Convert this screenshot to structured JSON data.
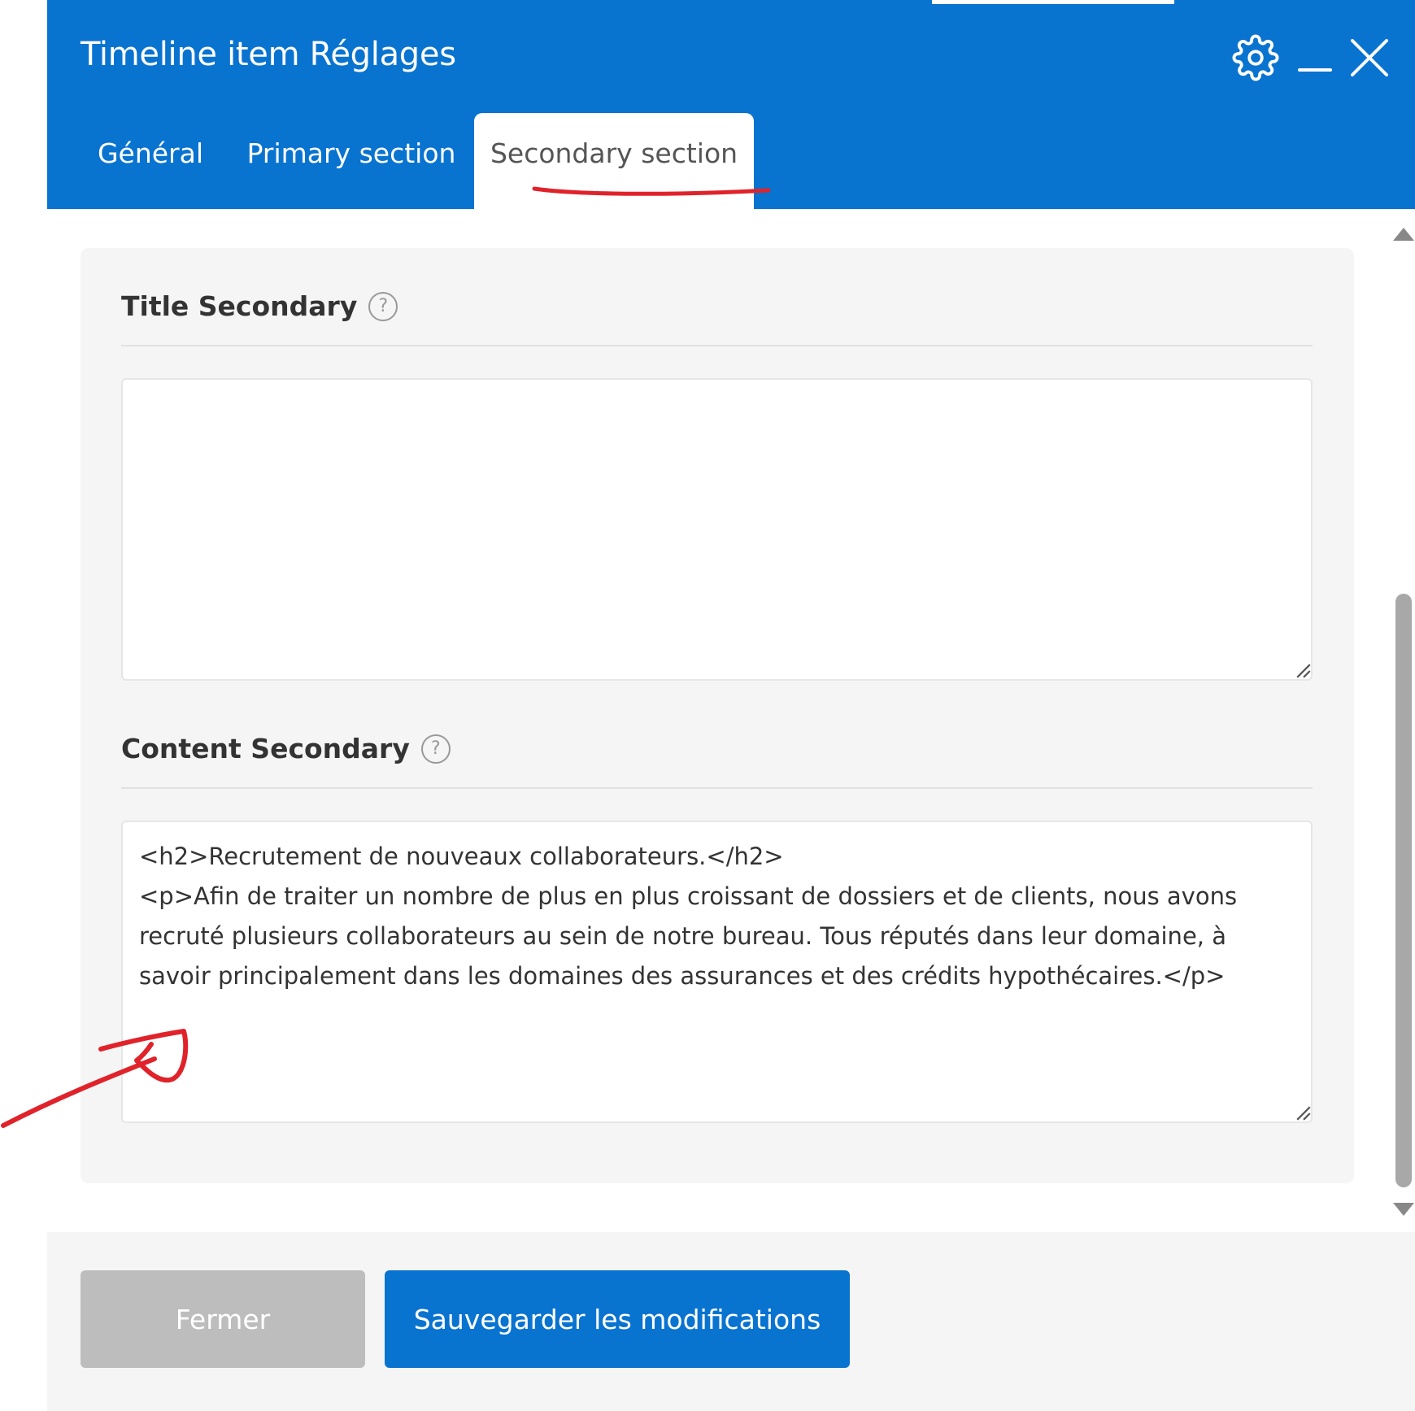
{
  "modal": {
    "title": "Timeline item Réglages"
  },
  "icons": {
    "settings": "gear-icon",
    "minimize": "minimize-icon",
    "close": "close-icon",
    "help": "question-circle-icon"
  },
  "tabs": [
    {
      "label": "Général",
      "active": false
    },
    {
      "label": "Primary section",
      "active": false
    },
    {
      "label": "Secondary section",
      "active": true
    }
  ],
  "fields": {
    "title_secondary": {
      "label": "Title Secondary",
      "help": "?",
      "value": ""
    },
    "content_secondary": {
      "label": "Content Secondary",
      "help": "?",
      "value": "<h2>Recrutement de nouveaux collaborateurs.</h2>\n<p>Afin de traiter un nombre de plus en plus croissant de dossiers et de clients, nous avons recruté plusieurs collaborateurs au sein de notre bureau. Tous réputés dans leur domaine, à savoir principalement dans les domaines des assurances et des crédits hypothécaires.</p>"
    }
  },
  "footer": {
    "close_label": "Fermer",
    "save_label": "Sauvegarder les modifications"
  },
  "colors": {
    "primary": "#0973d0",
    "panel": "#f5f5f5",
    "disabled_button": "#bdbdbd",
    "annotation": "#e0232b"
  }
}
